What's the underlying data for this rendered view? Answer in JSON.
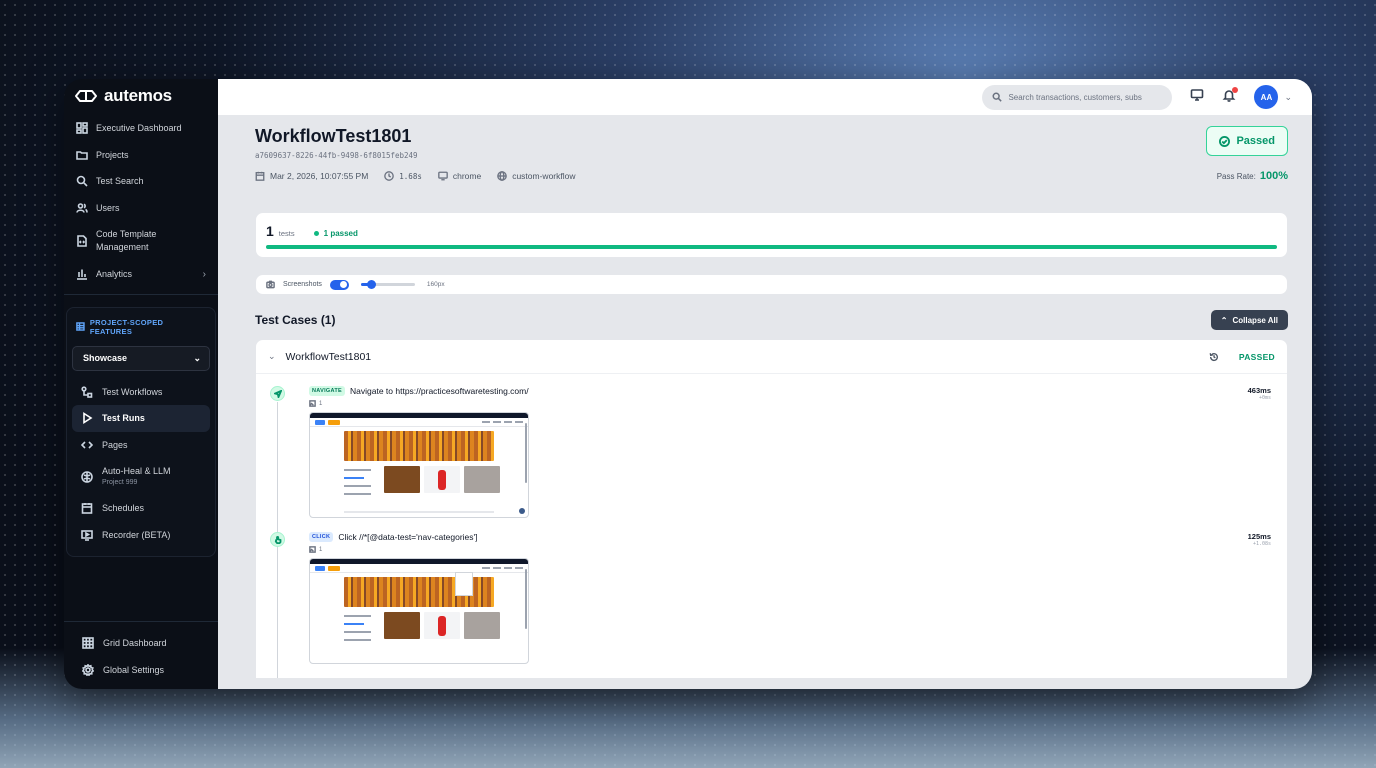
{
  "brand": {
    "name": "autemos"
  },
  "sidebar": {
    "items": [
      {
        "label": "Executive Dashboard",
        "icon": "dashboard-icon"
      },
      {
        "label": "Projects",
        "icon": "folder-icon"
      },
      {
        "label": "Test Search",
        "icon": "search-icon"
      },
      {
        "label": "Users",
        "icon": "users-icon"
      },
      {
        "label": "Code Template Management",
        "icon": "code-file-icon"
      },
      {
        "label": "Analytics",
        "icon": "bar-chart-icon"
      }
    ],
    "scoped": {
      "heading": "PROJECT-SCOPED FEATURES",
      "project_select": "Showcase",
      "items": [
        {
          "label": "Test Workflows",
          "icon": "workflow-icon"
        },
        {
          "label": "Test Runs",
          "icon": "play-icon",
          "active": true
        },
        {
          "label": "Pages",
          "icon": "code-brackets-icon"
        },
        {
          "label": "Auto-Heal & LLM",
          "sub": "Project 999",
          "icon": "auto-heal-icon"
        },
        {
          "label": "Schedules",
          "icon": "calendar-icon"
        },
        {
          "label": "Recorder (BETA)",
          "icon": "recorder-icon"
        }
      ]
    },
    "bottom": [
      {
        "label": "Grid Dashboard",
        "icon": "grid-icon"
      },
      {
        "label": "Global Settings",
        "icon": "gear-icon"
      }
    ]
  },
  "topbar": {
    "search_placeholder": "Search transactions, customers, subs",
    "avatar_initials": "AA"
  },
  "run": {
    "title": "WorkflowTest1801",
    "id": "a7609637-8226-44fb-9498-6f8015feb249",
    "status": "Passed",
    "date": "Mar 2, 2026, 10:07:55 PM",
    "duration": "1.68s",
    "browser": "chrome",
    "environment": "custom-workflow",
    "pass_rate_label": "Pass Rate:",
    "pass_rate": "100%"
  },
  "summary": {
    "count": "1",
    "count_label": "tests",
    "passed_label": "1 passed",
    "progress_fraction": 1.0
  },
  "screenshot_bar": {
    "label": "Screenshots",
    "enabled": true,
    "size_label": "160px",
    "size_fraction": 0.2
  },
  "test_cases": {
    "heading": "Test Cases (1)",
    "collapse_label": "Collapse All",
    "cases": [
      {
        "name": "WorkflowTest1801",
        "status": "PASSED",
        "steps": [
          {
            "type": "NAVIGATE",
            "description": "Navigate to https://practicesoftwaretesting.com/",
            "screenshots": "1",
            "duration": "463ms",
            "offset": "+0ms"
          },
          {
            "type": "CLICK",
            "description": "Click //*[@data-test='nav-categories']",
            "screenshots": "1",
            "duration": "125ms",
            "offset": "+1.08s"
          }
        ]
      }
    ]
  },
  "colors": {
    "accent": "#2563eb",
    "success": "#059669",
    "sidebar_bg": "#0b0f17"
  }
}
